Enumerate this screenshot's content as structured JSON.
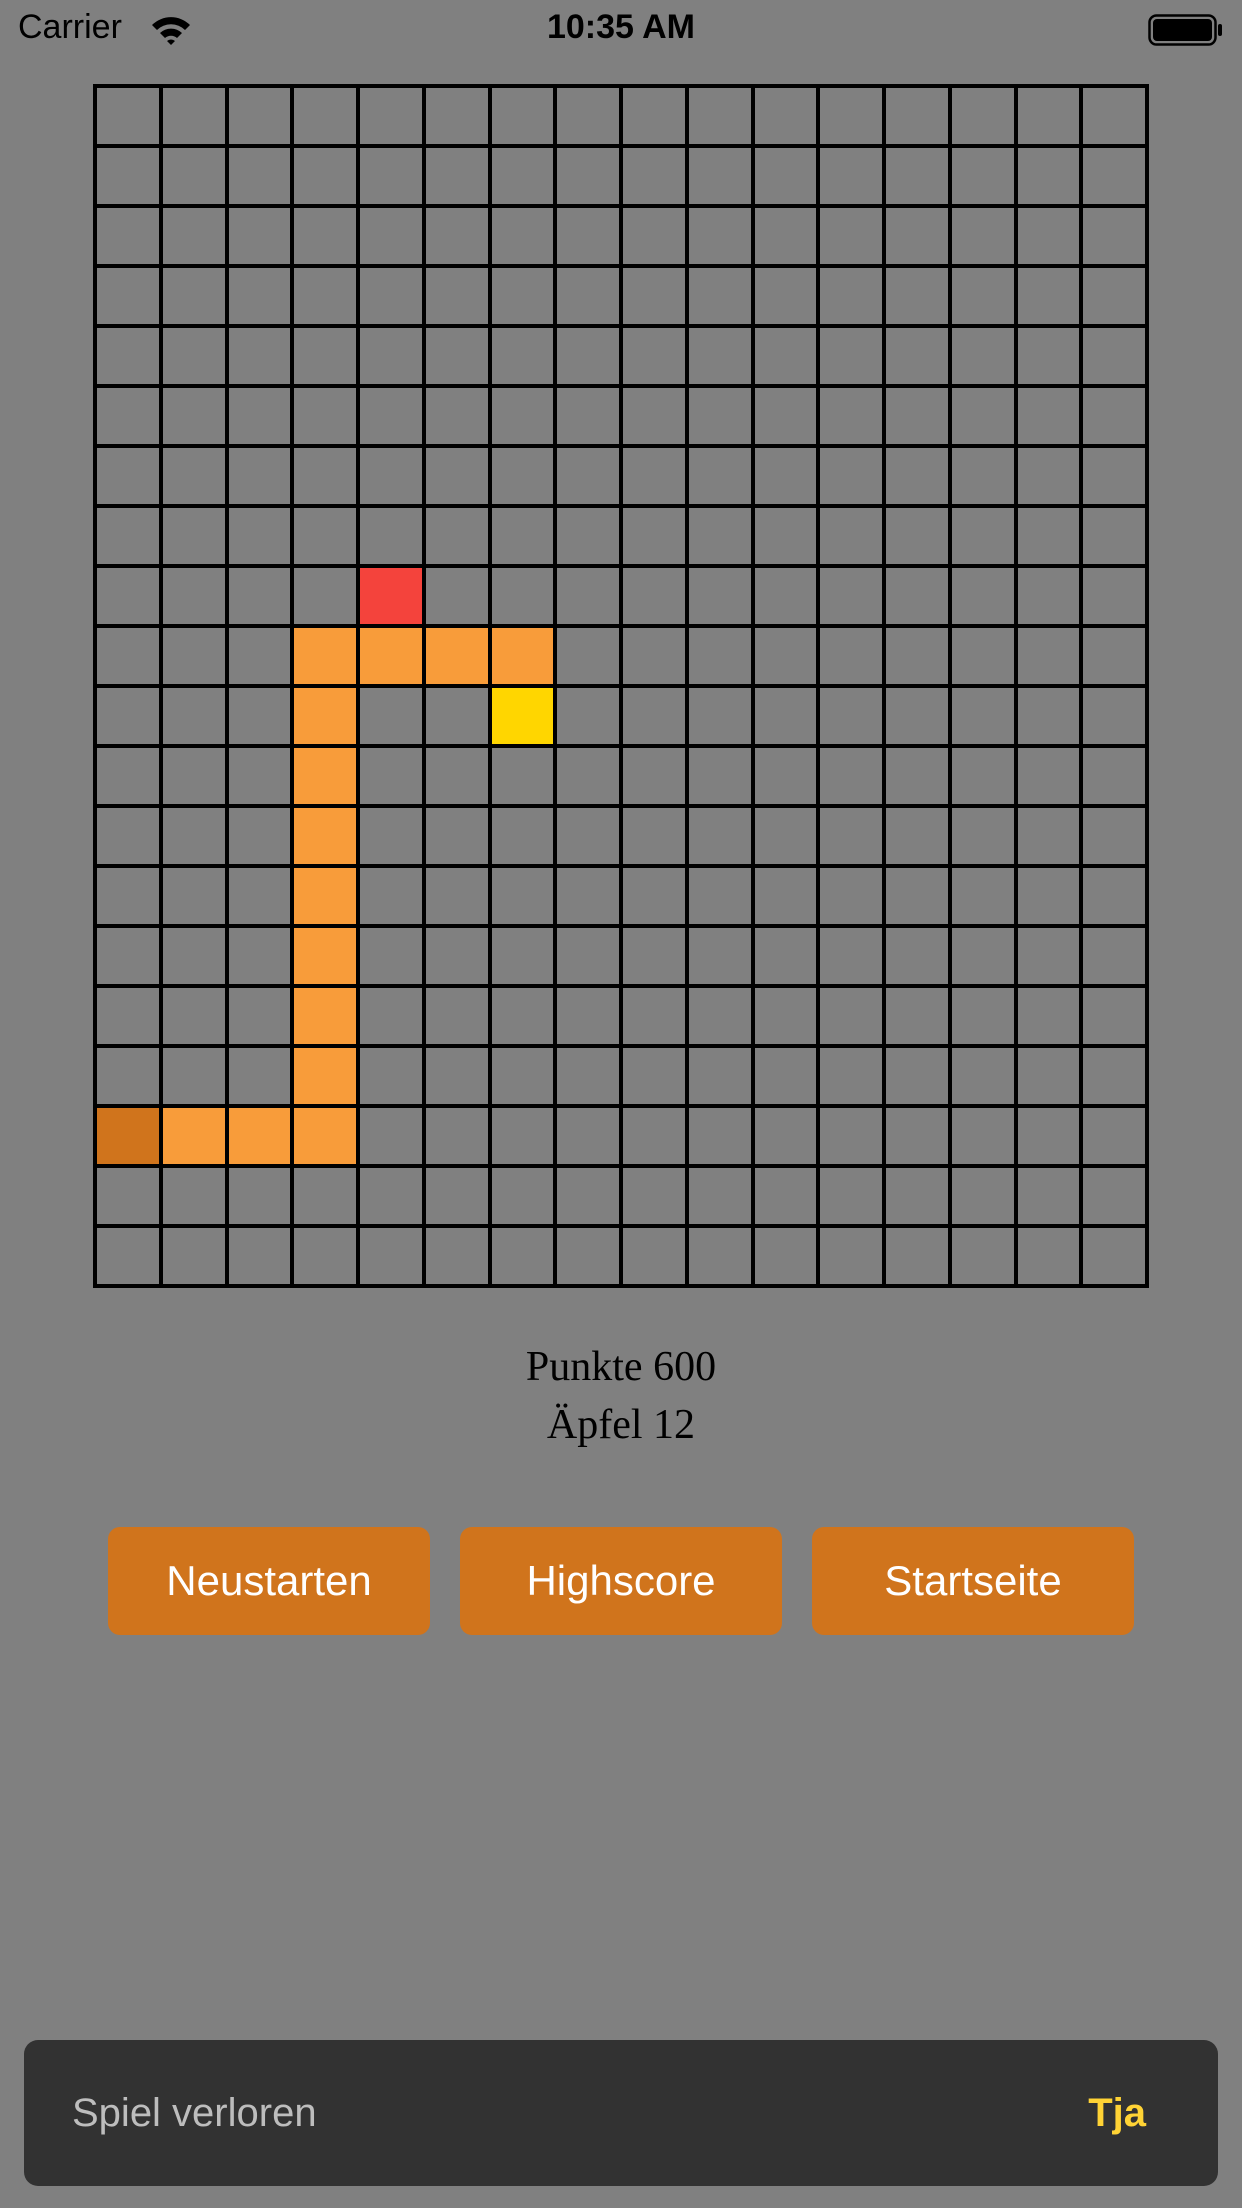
{
  "status_bar": {
    "carrier": "Carrier",
    "time": "10:35 AM"
  },
  "board": {
    "columns": 16,
    "rows": 20,
    "colors": {
      "empty": "#808080",
      "grid": "#000000",
      "snake_body": "#F89C3A",
      "snake_tail": "#D0741C",
      "apple": "#F4433C",
      "bonus": "#FFD600"
    },
    "snake_body": [
      [
        3,
        9
      ],
      [
        4,
        9
      ],
      [
        5,
        9
      ],
      [
        6,
        9
      ],
      [
        3,
        10
      ],
      [
        3,
        11
      ],
      [
        3,
        12
      ],
      [
        3,
        13
      ],
      [
        3,
        14
      ],
      [
        3,
        15
      ],
      [
        3,
        16
      ],
      [
        3,
        17
      ],
      [
        1,
        17
      ],
      [
        2,
        17
      ]
    ],
    "snake_tail": [
      [
        0,
        17
      ]
    ],
    "apple": [
      4,
      8
    ],
    "bonus": [
      6,
      10
    ]
  },
  "score": {
    "points": "Punkte 600",
    "apples": "Äpfel 12"
  },
  "buttons": {
    "restart": "Neustarten",
    "highscore": "Highscore",
    "home": "Startseite",
    "color": "#D0741C"
  },
  "snackbar": {
    "message": "Spiel verloren",
    "action": "Tja",
    "message_color": "#BDBDBD",
    "action_color": "#FFD335"
  }
}
